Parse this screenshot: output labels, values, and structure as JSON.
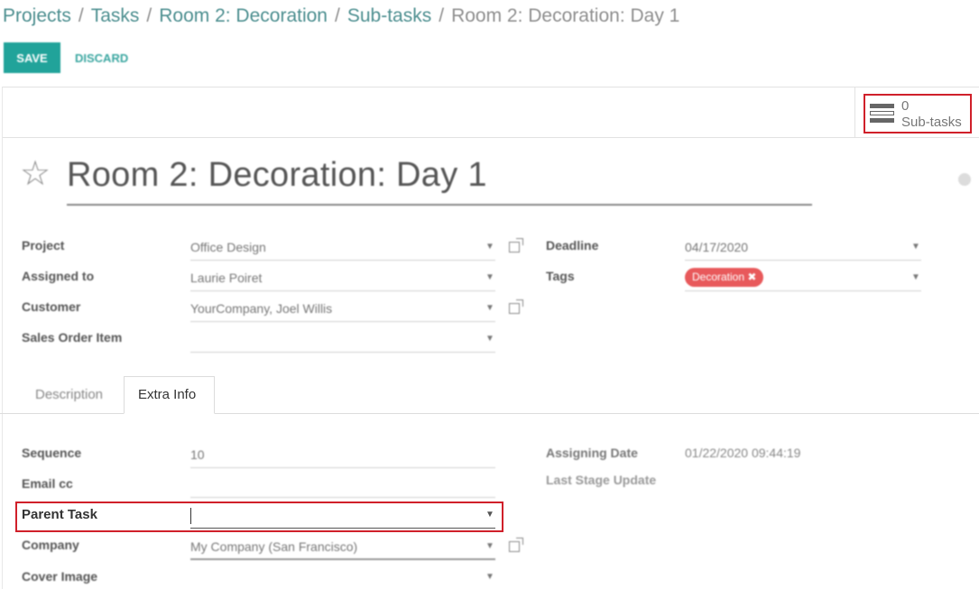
{
  "breadcrumb": {
    "items": [
      "Projects",
      "Tasks",
      "Room 2: Decoration",
      "Sub-tasks"
    ],
    "separator": "/",
    "active": "Room 2: Decoration: Day 1"
  },
  "toolbar": {
    "save_label": "SAVE",
    "discard_label": "DISCARD"
  },
  "smart_button": {
    "count": "0",
    "label": "Sub-tasks"
  },
  "task": {
    "title": "Room 2: Decoration: Day 1"
  },
  "fields_left": [
    {
      "label": "Project",
      "value": "Office Design"
    },
    {
      "label": "Assigned to",
      "value": "Laurie Poiret"
    },
    {
      "label": "Customer",
      "value": "YourCompany, Joel Willis"
    },
    {
      "label": "Sales Order Item",
      "value": ""
    }
  ],
  "fields_right": [
    {
      "label": "Deadline",
      "value": "04/17/2020"
    },
    {
      "label": "Tags",
      "tag": "Decoration"
    }
  ],
  "tabs": [
    {
      "label": "Description",
      "active": false
    },
    {
      "label": "Extra Info",
      "active": true
    }
  ],
  "extra_info": {
    "sequence_label": "Sequence",
    "sequence_value": "10",
    "email_cc_label": "Email cc",
    "email_cc_value": "",
    "parent_task_label": "Parent Task",
    "parent_task_value": "",
    "company_label": "Company",
    "company_value": "My Company (San Francisco)",
    "cover_image_label": "Cover Image",
    "cover_image_value": "",
    "assigning_date_label": "Assigning Date",
    "assigning_date_value": "01/22/2020 09:44:19",
    "last_stage_update_label": "Last Stage Update"
  },
  "colors": {
    "primary": "#21a39a",
    "link": "#4d8f90",
    "highlight": "#d0202a",
    "tag": "#e8595b"
  }
}
